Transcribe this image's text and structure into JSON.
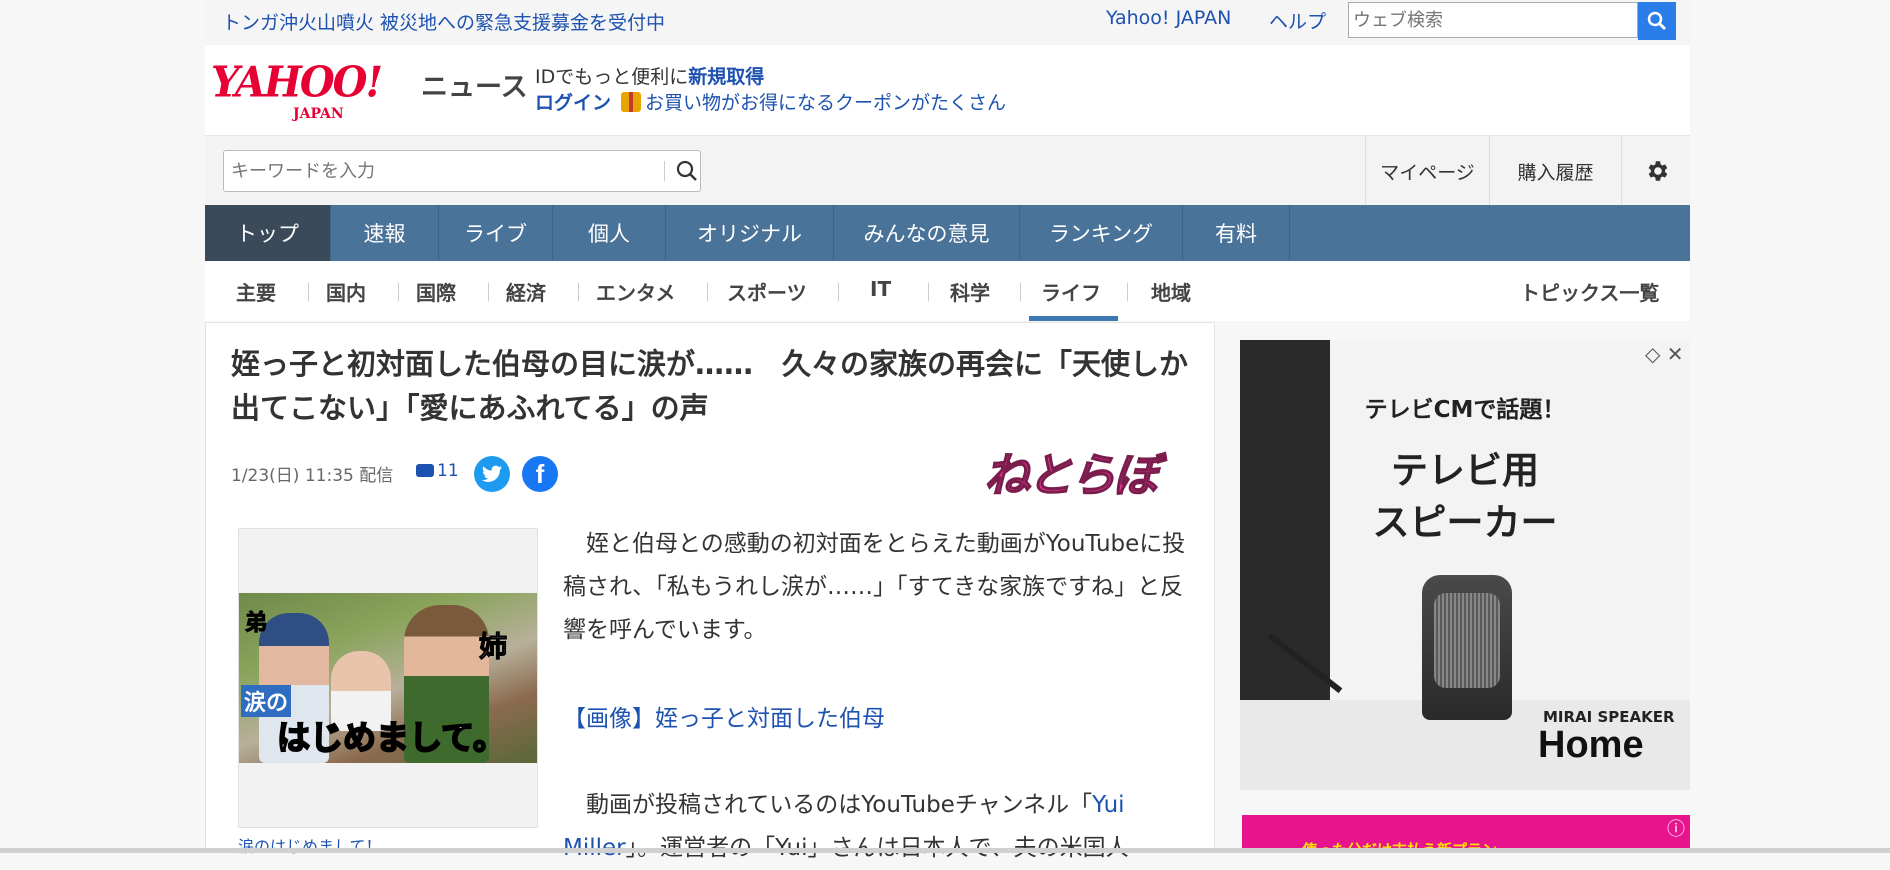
{
  "topbar": {
    "notice": "トンガ沖火山噴火 被災地への緊急支援募金を受付中",
    "yahoo_japan": "Yahoo! JAPAN",
    "help": "ヘルプ",
    "web_search_placeholder": "ウェブ検索"
  },
  "header": {
    "logo_yahoo": "YAHOO!",
    "logo_japan": "JAPAN",
    "logo_news": "ニュース",
    "promo_prefix": "IDでもっと便利に",
    "promo_signup": "新規取得",
    "login": "ログイン",
    "coupon": "お買い物がお得になるクーポンがたくさん"
  },
  "search": {
    "placeholder": "キーワードを入力",
    "mypage": "マイページ",
    "history": "購入履歴"
  },
  "main_nav": [
    {
      "label": "トップ",
      "active": true
    },
    {
      "label": "速報"
    },
    {
      "label": "ライブ"
    },
    {
      "label": "個人"
    },
    {
      "label": "オリジナル"
    },
    {
      "label": "みんなの意見"
    },
    {
      "label": "ランキング"
    },
    {
      "label": "有料"
    }
  ],
  "sub_nav": {
    "items": [
      "主要",
      "国内",
      "国際",
      "経済",
      "エンタメ",
      "スポーツ",
      "IT",
      "科学",
      "ライフ",
      "地域"
    ],
    "active": "ライフ",
    "all_topics": "トピックス一覧"
  },
  "article": {
    "headline": "姪っ子と初対面した伯母の目に涙が……　久々の家族の再会に「天使しか出てこない」「愛にあふれてる」の声",
    "date": "1/23(日) 11:35 配信",
    "comments": "11",
    "source_logo": "ねとらぼ",
    "image_captions": {
      "left": "弟",
      "right": "姉",
      "tear": "涙の",
      "main": "はじめまして。"
    },
    "image_caption_link": "涙のはじめまして！",
    "body1": "　姪と伯母との感動の初対面をとらえた動画がYouTubeに投稿され、「私もうれし涙が……」「すてきな家族ですね」と反響を呼んでいます。",
    "image_link": "【画像】姪っ子と対面した伯母",
    "body2_prefix": "　動画が投稿されているのはYouTubeチャンネル「",
    "body2_link": "Yui Miller",
    "body2_suffix": "」。運営者の「Yui」さんは日本人で、夫の米国人"
  },
  "ad": {
    "line1": "テレビCMで話題！",
    "line2": "テレビ用",
    "line3": "スピーカー",
    "brand": "MIRAI SPEAKER",
    "product": "Home",
    "ad2_text": "使った分だけ支払う新プラン"
  }
}
